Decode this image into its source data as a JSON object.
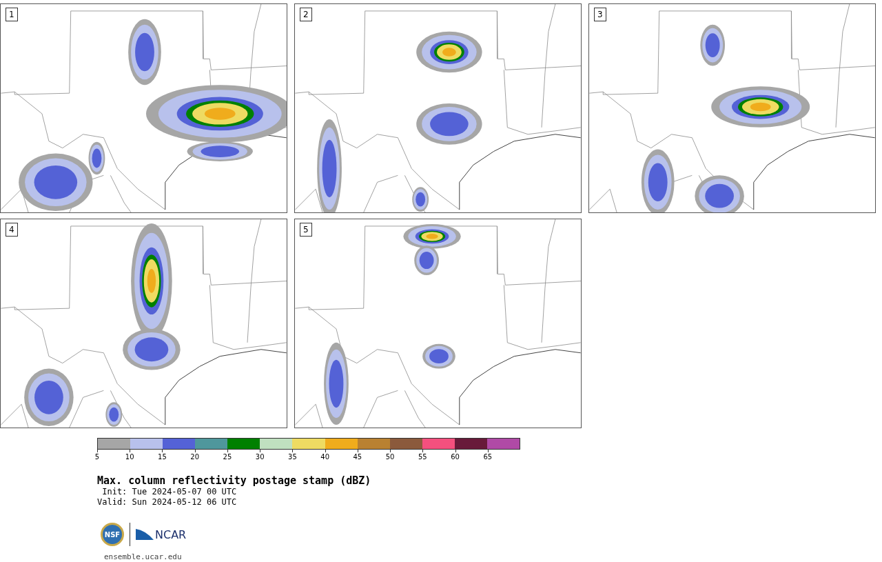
{
  "panels": [
    {
      "label": "1"
    },
    {
      "label": "2"
    },
    {
      "label": "3"
    },
    {
      "label": "4"
    },
    {
      "label": "5"
    }
  ],
  "colorbar": {
    "segments": [
      {
        "color": "#a6a6a6"
      },
      {
        "color": "#b8c1ec"
      },
      {
        "color": "#5462d6"
      },
      {
        "color": "#4f979c"
      },
      {
        "color": "#008000"
      },
      {
        "color": "#c0e0c0"
      },
      {
        "color": "#eedb62"
      },
      {
        "color": "#f0ac1c"
      },
      {
        "color": "#b98131"
      },
      {
        "color": "#8b5a3c"
      },
      {
        "color": "#f4507e"
      },
      {
        "color": "#681a3a"
      },
      {
        "color": "#b04aa6"
      }
    ],
    "ticks": [
      "5",
      "10",
      "15",
      "20",
      "25",
      "30",
      "35",
      "40",
      "45",
      "50",
      "55",
      "60",
      "65"
    ]
  },
  "title": "Max. column reflectivity postage stamp (dBZ)",
  "init": " Init: Tue 2024-05-07 00 UTC",
  "valid": "Valid: Sun 2024-05-12 06 UTC",
  "logos": {
    "left": "NSF",
    "right": "NCAR"
  },
  "footer": "ensemble.ucar.edu"
}
